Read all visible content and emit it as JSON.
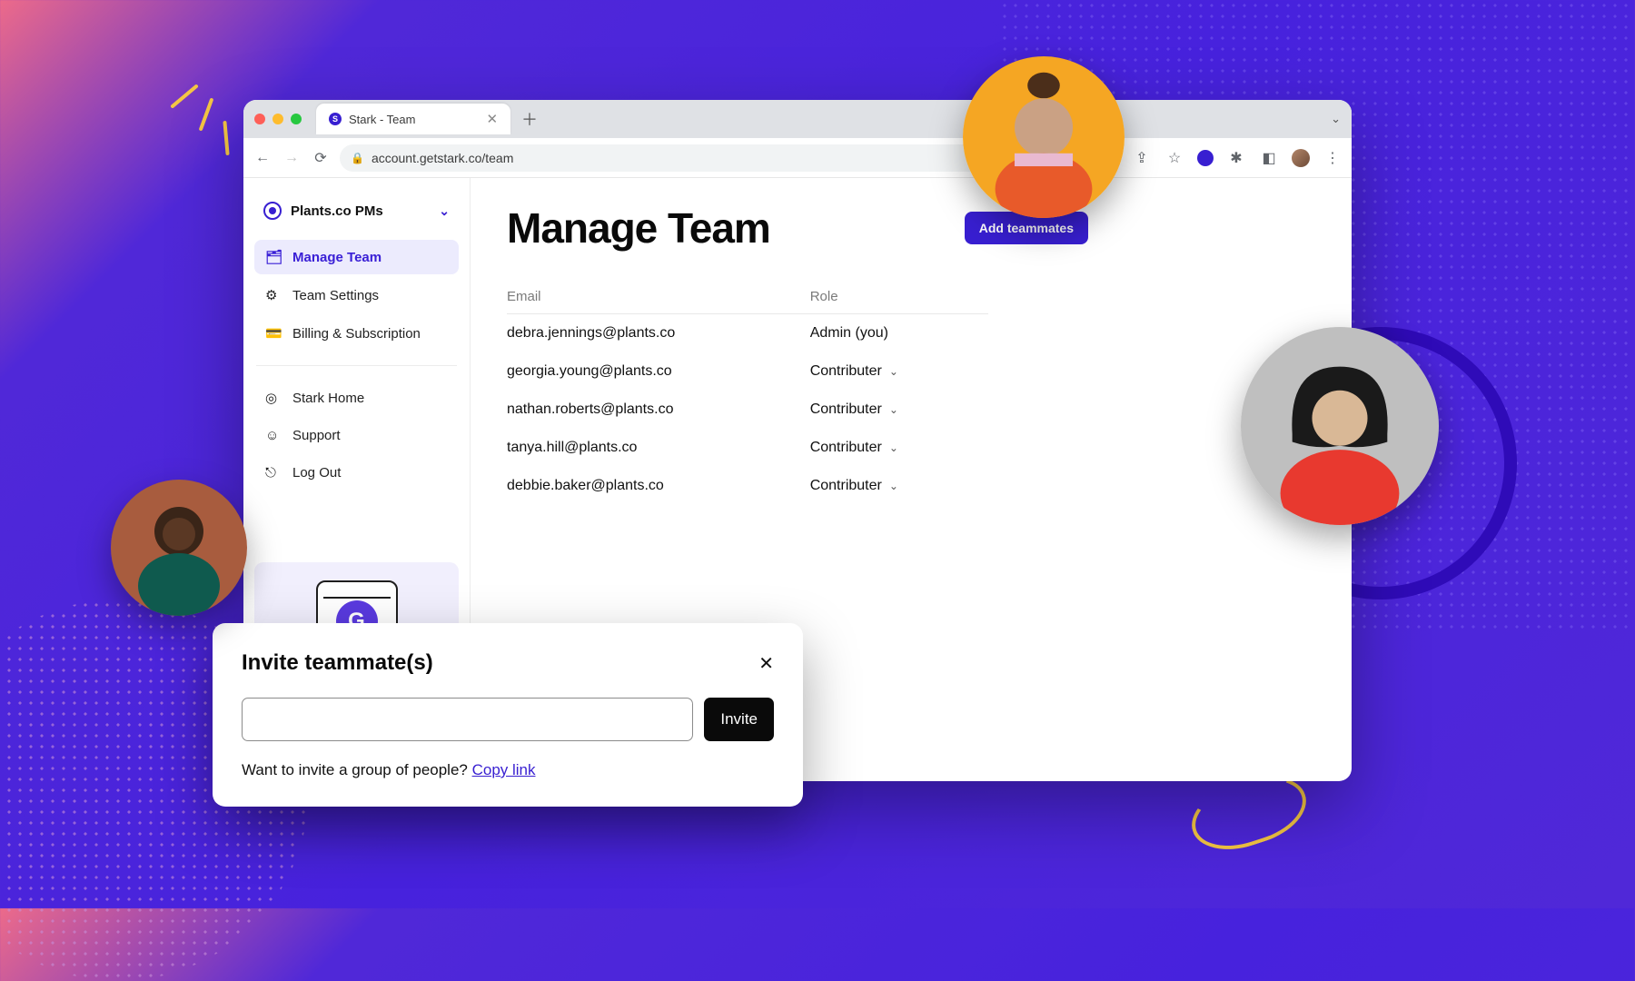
{
  "browser": {
    "tab_title": "Stark - Team",
    "url": "account.getstark.co/team"
  },
  "sidebar": {
    "team_name": "Plants.co PMs",
    "nav": [
      {
        "label": "Manage Team"
      },
      {
        "label": "Team Settings"
      },
      {
        "label": "Billing & Subscription"
      }
    ],
    "nav2": [
      {
        "label": "Stark Home"
      },
      {
        "label": "Support"
      },
      {
        "label": "Log Out"
      }
    ]
  },
  "main": {
    "title": "Manage Team",
    "add_button": "Add teammates",
    "columns": {
      "email": "Email",
      "role": "Role"
    },
    "rows": [
      {
        "email": "debra.jennings@plants.co",
        "role": "Admin (you)",
        "dropdown": false
      },
      {
        "email": "georgia.young@plants.co",
        "role": "Contributer",
        "dropdown": true
      },
      {
        "email": "nathan.roberts@plants.co",
        "role": "Contributer",
        "dropdown": true
      },
      {
        "email": "tanya.hill@plants.co",
        "role": "Contributer",
        "dropdown": true
      },
      {
        "email": "debbie.baker@plants.co",
        "role": "Contributer",
        "dropdown": true
      }
    ]
  },
  "modal": {
    "title": "Invite teammate(s)",
    "invite_button": "Invite",
    "footer_text": "Want to invite a group of people? ",
    "footer_link": "Copy link"
  }
}
